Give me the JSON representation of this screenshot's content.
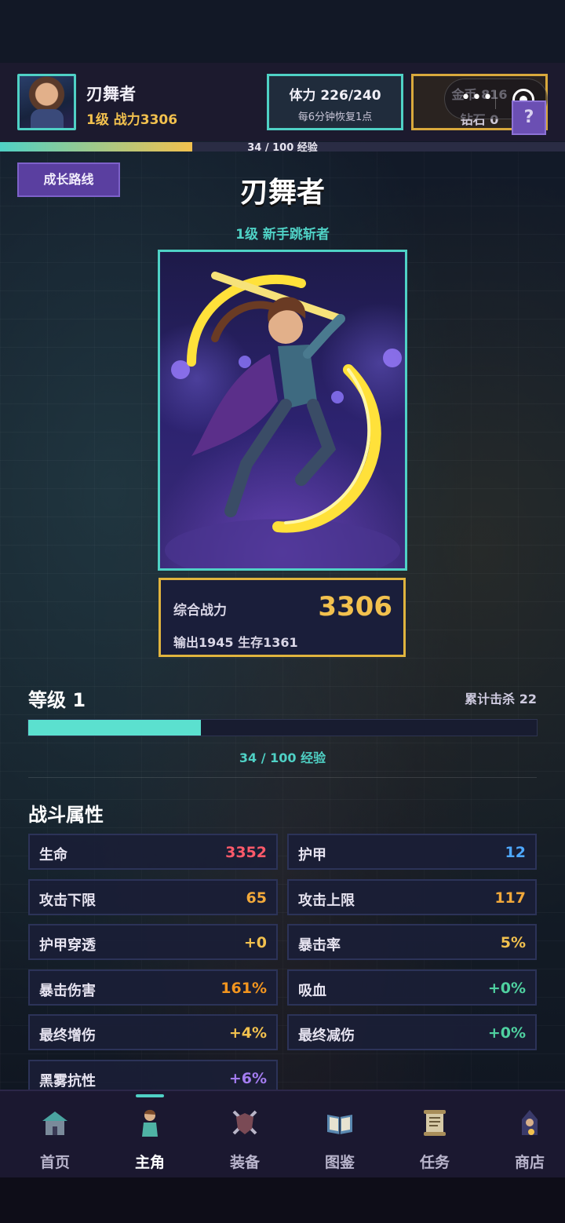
{
  "header": {
    "hero_name": "刃舞者",
    "hero_level_power": "1级  战力3306",
    "stamina": "体力 226/240",
    "stamina_recover": "每6分钟恢复1点",
    "gold": "金币 816",
    "diamond": "钻石 0",
    "help": "?"
  },
  "top_exp": {
    "text": "34 / 100 经验",
    "progress": 0.34
  },
  "growth_button": "成长路线",
  "character": {
    "class_title": "刃舞者",
    "subtitle": "1级  新手跳斩者"
  },
  "power_card": {
    "label": "综合战力",
    "value": "3306",
    "detail": "输出1945  生存1361"
  },
  "level": {
    "title": "等级 1",
    "kills": "累计击杀 22",
    "exp_text": "34 / 100 经验",
    "progress": 0.34
  },
  "combat": {
    "title": "战斗属性",
    "stats": [
      {
        "key": "生命",
        "value": "3352",
        "color": "#ff5a6a"
      },
      {
        "key": "护甲",
        "value": "12",
        "color": "#4ea8ff"
      },
      {
        "key": "攻击下限",
        "value": "65",
        "color": "#f2a93b"
      },
      {
        "key": "攻击上限",
        "value": "117",
        "color": "#f2a93b"
      },
      {
        "key": "护甲穿透",
        "value": "+0",
        "color": "#f2c14e"
      },
      {
        "key": "暴击率",
        "value": "5%",
        "color": "#f2c14e"
      },
      {
        "key": "暴击伤害",
        "value": "161%",
        "color": "#f2951f"
      },
      {
        "key": "吸血",
        "value": "+0%",
        "color": "#4fd1a0"
      },
      {
        "key": "最终增伤",
        "value": "+4%",
        "color": "#f2c14e"
      },
      {
        "key": "最终减伤",
        "value": "+0%",
        "color": "#4fd1a0"
      },
      {
        "key": "黑雾抗性",
        "value": "+6%",
        "color": "#a37cf0"
      }
    ]
  },
  "nav": [
    {
      "label": "首页",
      "icon": "house-icon"
    },
    {
      "label": "主角",
      "icon": "hero-icon",
      "active": true
    },
    {
      "label": "装备",
      "icon": "shield-swords-icon"
    },
    {
      "label": "图鉴",
      "icon": "book-icon"
    },
    {
      "label": "任务",
      "icon": "scroll-icon"
    },
    {
      "label": "商店",
      "icon": "merchant-icon"
    }
  ]
}
